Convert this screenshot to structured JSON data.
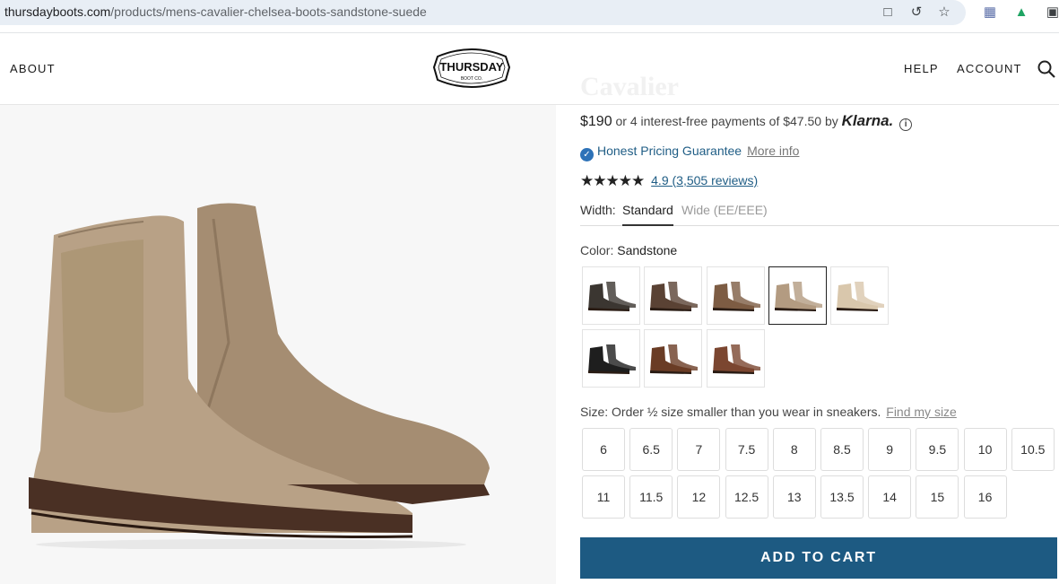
{
  "browser": {
    "url_host": "thursdayboots.com",
    "url_path": "/products/mens-cavalier-chelsea-boots-sandstone-suede"
  },
  "header": {
    "nav_left": "ABOUT",
    "nav_help": "HELP",
    "nav_account": "ACCOUNT",
    "logo_text_main": "THURSDAY",
    "logo_text_sub": "BOOT CO."
  },
  "product": {
    "title": "Cavalier",
    "price": "$190",
    "installments": "or 4 interest-free payments of $47.50 by",
    "klarna": "Klarna.",
    "guarantee": "Honest Pricing Guarantee",
    "more_info": "More info",
    "rating_text": "4.9 (3,505 reviews)",
    "rating_value": 4.9,
    "width_label": "Width:",
    "width_standard": "Standard",
    "width_wide": "Wide (EE/EEE)",
    "color_label": "Color:",
    "color_selected": "Sandstone",
    "swatch_colors": [
      "#3b3631",
      "#5a4234",
      "#7d5c43",
      "#b39b81",
      "#d9c7ac",
      "#1e1e1e",
      "#6a3c25",
      "#7b4630"
    ],
    "size_label": "Size: Order ½ size smaller than you wear in sneakers.",
    "find_size": "Find my size",
    "sizes": [
      "6",
      "6.5",
      "7",
      "7.5",
      "8",
      "8.5",
      "9",
      "9.5",
      "10",
      "10.5",
      "11",
      "11.5",
      "12",
      "12.5",
      "13",
      "13.5",
      "14",
      "15",
      "16"
    ],
    "add_to_cart": "ADD TO CART"
  },
  "colors": {
    "accent": "#1d5a82",
    "link": "#1f5d85",
    "boot_main": "#b39b81"
  }
}
